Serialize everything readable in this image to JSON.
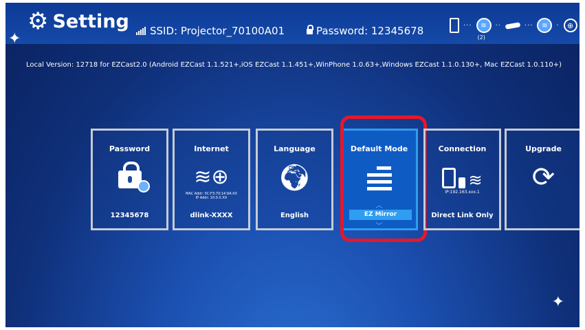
{
  "header": {
    "title": "Setting",
    "ssid_label": "SSID: Projector_70100A01",
    "password_label": "Password: 12345678",
    "connected_count": "(2)"
  },
  "version_text": "Local Version: 12718 for EZCast2.0  (Android EZCast 1.1.521+,iOS EZCast 1.1.451+,WinPhone 1.0.63+,Windows EZCast 1.1.0.130+, Mac EZCast 1.0.110+)",
  "tiles": [
    {
      "label": "Password",
      "value": "12345678"
    },
    {
      "label": "Internet",
      "value": "dlink-XXXX",
      "mac": "MAC Addr: 5C:F3:70:14:9A:XX",
      "ip": "IP Addr: 10.0.X.XX"
    },
    {
      "label": "Language",
      "value": "English"
    },
    {
      "label": "Default Mode",
      "value": "EZ Mirror"
    },
    {
      "label": "Connection",
      "value": "Direct Link Only",
      "ip": "IP:192.163.xxx.1"
    },
    {
      "label": "Upgrade",
      "value": ""
    }
  ],
  "colors": {
    "background": "#1b4fb0",
    "selected_tile": "#0f5bc4",
    "selected_accent": "#2f9df0",
    "highlight": "#e5182b"
  }
}
